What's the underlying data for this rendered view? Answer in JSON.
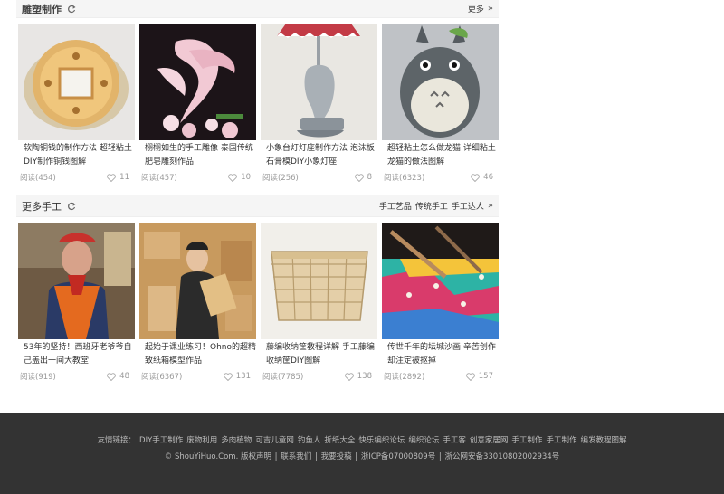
{
  "section1": {
    "title": "雕塑制作",
    "more": "更多",
    "cards": [
      {
        "title": "软陶铜钱的制作方法 超轻粘土DIY制作铜钱图解",
        "reads": "阅读(454)",
        "likes": "11"
      },
      {
        "title": "栩栩如生的手工雕像 泰国传统肥皂雕刻作品",
        "reads": "阅读(457)",
        "likes": "10"
      },
      {
        "title": "小象台灯灯座制作方法 泡沫板石膏模DIY小象灯座",
        "reads": "阅读(256)",
        "likes": "8"
      },
      {
        "title": "超轻粘土怎么做龙猫 详细粘土龙猫的做法图解",
        "reads": "阅读(6323)",
        "likes": "46"
      }
    ]
  },
  "section2": {
    "title": "更多手工",
    "links": [
      "手工艺品",
      "传统手工",
      "手工达人"
    ],
    "cards": [
      {
        "title": "53年的坚持！西班牙老爷爷自己盖出一间大教堂",
        "reads": "阅读(919)",
        "likes": "48"
      },
      {
        "title": "起始于课业练习！Ohno的超精致纸箱模型作品",
        "reads": "阅读(6367)",
        "likes": "131"
      },
      {
        "title": "藤编收纳筐教程详解 手工藤编收纳筐DIY图解",
        "reads": "阅读(7785)",
        "likes": "138"
      },
      {
        "title": "传世千年的坛城沙画 辛苦创作却注定被抠掉",
        "reads": "阅读(2892)",
        "likes": "157"
      }
    ]
  },
  "footer": {
    "links_label": "友情链接：",
    "links": [
      "DIY手工制作",
      "废物利用",
      "多肉植物",
      "可吉儿童网",
      "钓鱼人",
      "折纸大全",
      "快乐编织论坛",
      "编织论坛",
      "手工客",
      "创意家居网",
      "手工制作",
      "手工制作",
      "编发教程图解"
    ],
    "copyright": "© ShouYiHuo.Com. 版权声明",
    "items": [
      "联系我们",
      "我要投稿",
      "浙ICP备07000809号",
      "浙公网安备33010802002934号"
    ]
  },
  "colors": {
    "footer_bg": "#333333",
    "header_bg": "#f5f5f5"
  }
}
